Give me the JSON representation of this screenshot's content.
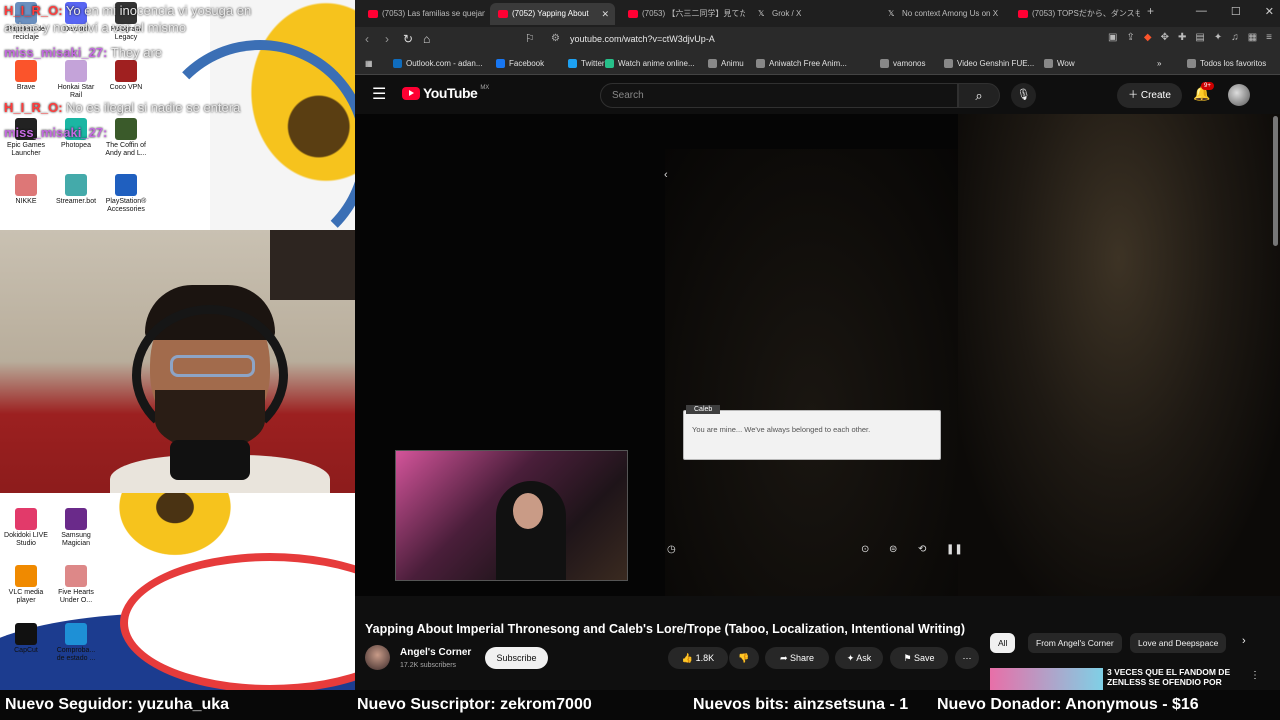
{
  "overlay": {
    "chat": [
      {
        "user": "H_I_R_O:",
        "message": "Yo en mi inocencia vi yosuga en"
      },
      {
        "user": "",
        "message": "anime y no volví a ver el mismo"
      },
      {
        "user": "miss_misaki_27:",
        "message": "They are"
      },
      {
        "user": "H_I_R_O:",
        "message": "No es ilegal si nadie se entera"
      },
      {
        "user": "miss_misaki_27:",
        "message": ""
      }
    ],
    "desktop_icons": [
      {
        "label": "Papelera de reciclaje",
        "color": "#6a8fbf"
      },
      {
        "label": "Discord",
        "color": "#5865f2"
      },
      {
        "label": "Hologram Legacy",
        "color": "#333"
      },
      {
        "label": "Brave",
        "color": "#fb542b"
      },
      {
        "label": "Honkai Star Rail",
        "color": "#c4a3d9"
      },
      {
        "label": "Coco VPN",
        "color": "#a02020"
      },
      {
        "label": "Epic Games Launcher",
        "color": "#222"
      },
      {
        "label": "Photopea",
        "color": "#1bb6a3"
      },
      {
        "label": "The Coffin of Andy and L...",
        "color": "#3a5a2a"
      },
      {
        "label": "NIKKE",
        "color": "#d77"
      },
      {
        "label": "Streamer.bot",
        "color": "#4aa"
      },
      {
        "label": "PlayStation® Accessories",
        "color": "#1f5fbf"
      },
      {
        "label": "Dokidoki LIVE Studio",
        "color": "#e23a6a"
      },
      {
        "label": "Samsung Magician",
        "color": "#6a2a8a"
      },
      {
        "label": "VLC media player",
        "color": "#f08a00"
      },
      {
        "label": "Five Hearts Under O...",
        "color": "#d88"
      },
      {
        "label": "CapCut",
        "color": "#111"
      },
      {
        "label": "Comproba... de estado ...",
        "color": "#1e90d6"
      }
    ]
  },
  "browser": {
    "tabs": [
      {
        "title": "(7053) Las familias se quejan",
        "active": false
      },
      {
        "title": "(7052) Yapping About",
        "active": true
      },
      {
        "title": "(7053) 【六三二同学】見てた",
        "active": false
      },
      {
        "title": "Grok / X",
        "active": false
      },
      {
        "title": "No context Among Us on X",
        "active": false
      },
      {
        "title": "(7053) TOPSだから、ダンスも...",
        "active": false
      }
    ],
    "url": "youtube.com/watch?v=ctW3djvUp-A",
    "bookmarks": [
      {
        "label": "Outlook.com - adan...",
        "color": "#0f6cbd"
      },
      {
        "label": "Facebook",
        "color": "#1877f2"
      },
      {
        "label": "Twitter",
        "color": "#1da1f2"
      },
      {
        "label": "Watch anime online...",
        "color": "#27c08a"
      },
      {
        "label": "Animu",
        "color": "#888"
      },
      {
        "label": "Aniwatch Free Anim...",
        "color": "#888"
      },
      {
        "label": "vamonos",
        "color": "#888"
      },
      {
        "label": "Video Genshin FUE...",
        "color": "#888"
      },
      {
        "label": "Wow",
        "color": "#888"
      }
    ],
    "bookmarks_all": "Todos los favoritos"
  },
  "youtube": {
    "logo": "YouTube",
    "country_code": "MX",
    "search_placeholder": "Search",
    "create_label": "Create",
    "notification_count": "9+",
    "video": {
      "dialog_speaker": "Caleb",
      "dialog_text": "You are mine... We've always belonged to each other."
    },
    "title": "Yapping About Imperial Thronesong and Caleb's Lore/Trope (Taboo, Localization, Intentional Writing)",
    "channel": "Angel's Corner",
    "subscribers": "17.2K subscribers",
    "subscribe_label": "Subscribe",
    "likes": "1.8K",
    "share_label": "Share",
    "ask_label": "Ask",
    "save_label": "Save",
    "chips": [
      "All",
      "From Angel's Corner",
      "Love and Deepspace"
    ],
    "recommendation_title": "3 VECES QUE EL FANDOM DE ZENLESS SE OFENDIO POR"
  },
  "ticker": {
    "follower": "Nuevo Seguidor: yuzuha_uka",
    "subscriber": "Nuevo Suscriptor: zekrom7000",
    "bits": "Nuevos bits: ainzsetsuna - 1",
    "donor": "Nuevo Donador: Anonymous - $16"
  }
}
